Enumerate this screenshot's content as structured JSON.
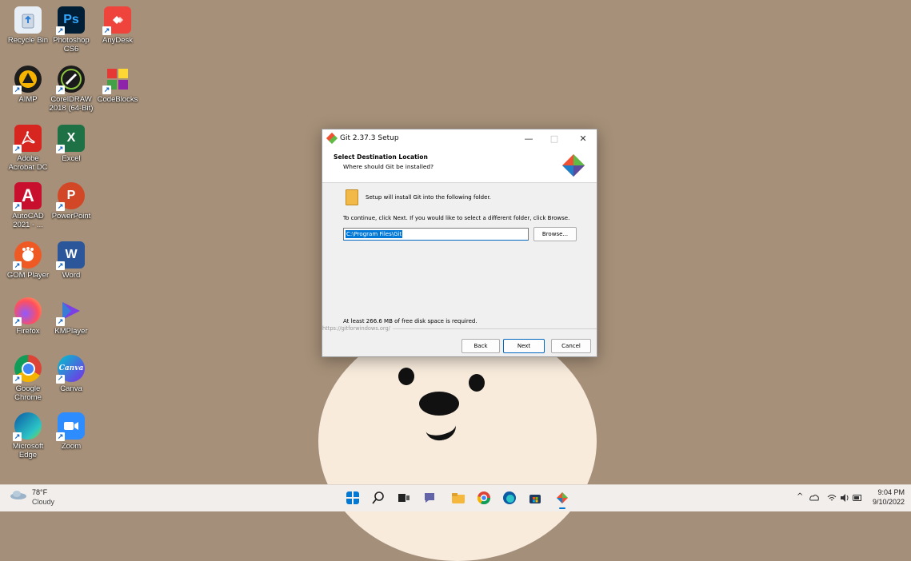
{
  "desktop": {
    "icons": [
      {
        "label": "Recycle Bin",
        "icon": "recycle-bin-icon"
      },
      {
        "label": "Photoshop CS6",
        "icon": "photoshop-icon",
        "glyph": "Ps"
      },
      {
        "label": "AnyDesk",
        "icon": "anydesk-icon"
      },
      {
        "label": "AIMP",
        "icon": "aimp-icon"
      },
      {
        "label": "CorelDRAW 2018 (64-Bit)",
        "icon": "coreldraw-icon"
      },
      {
        "label": "CodeBlocks",
        "icon": "codeblocks-icon"
      },
      {
        "label": "Adobe Acrobat DC",
        "icon": "acrobat-icon"
      },
      {
        "label": "Excel",
        "icon": "excel-icon",
        "glyph": "X"
      },
      {
        "label": "AutoCAD 2021 - ...",
        "icon": "autocad-icon",
        "glyph": "A"
      },
      {
        "label": "PowerPoint",
        "icon": "powerpoint-icon",
        "glyph": "P"
      },
      {
        "label": "GOM Player",
        "icon": "gom-player-icon"
      },
      {
        "label": "Word",
        "icon": "word-icon",
        "glyph": "W"
      },
      {
        "label": "Firefox",
        "icon": "firefox-icon"
      },
      {
        "label": "KMPlayer",
        "icon": "kmplayer-icon"
      },
      {
        "label": "Google Chrome",
        "icon": "chrome-icon"
      },
      {
        "label": "Canva",
        "icon": "canva-icon",
        "glyph": "Canva"
      },
      {
        "label": "Microsoft Edge",
        "icon": "edge-icon"
      },
      {
        "label": "Zoom",
        "icon": "zoom-icon"
      }
    ]
  },
  "setup": {
    "title": "Git 2.37.3 Setup",
    "heading": "Select Destination Location",
    "subheading": "Where should Git be installed?",
    "intro": "Setup will install Git into the following folder.",
    "instructions": "To continue, click Next. If you would like to select a different folder, click Browse.",
    "path_value": "C:\\Program Files\\Git",
    "browse_label": "Browse...",
    "space_text": "At least 266.6 MB of free disk space is required.",
    "url": "https://gitforwindows.org/",
    "back_label": "Back",
    "next_label": "Next",
    "cancel_label": "Cancel",
    "minimize_glyph": "—",
    "maximize_glyph": "□",
    "close_glyph": "✕"
  },
  "taskbar": {
    "weather_temp": "78°F",
    "weather_condition": "Cloudy",
    "pinned": [
      "start-icon",
      "search-icon",
      "task-view-icon",
      "chat-icon",
      "file-explorer-icon",
      "chrome-icon",
      "edge-icon",
      "store-icon",
      "git-setup-icon"
    ],
    "tray_chevron": "^",
    "time": "9:04 PM",
    "date": "9/10/2022"
  }
}
